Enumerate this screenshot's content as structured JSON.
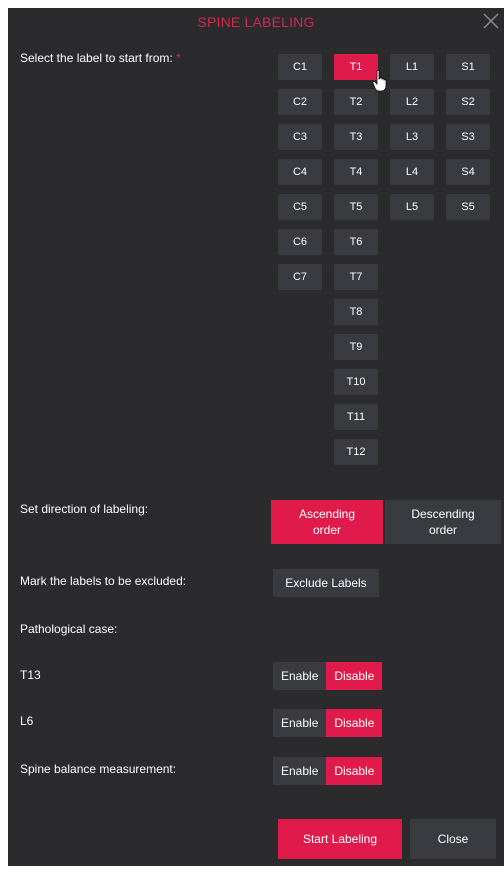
{
  "dialog": {
    "title": "SPINE LABELING",
    "start_prompt": "Select the label to start from:",
    "required_mark": "*",
    "cervical": [
      "C1",
      "C2",
      "C3",
      "C4",
      "C5",
      "C6",
      "C7"
    ],
    "thoracic": [
      "T1",
      "T2",
      "T3",
      "T4",
      "T5",
      "T6",
      "T7",
      "T8",
      "T9",
      "T10",
      "T11",
      "T12"
    ],
    "lumbar": [
      "L1",
      "L2",
      "L3",
      "L4",
      "L5"
    ],
    "sacral": [
      "S1",
      "S2",
      "S3",
      "S4",
      "S5"
    ],
    "selected_label": "T1",
    "direction_label": "Set direction of labeling:",
    "ascending_line1": "Ascending",
    "ascending_line2": "order",
    "descending_line1": "Descending",
    "descending_line2": "order",
    "selected_direction": "ascending",
    "exclude_prompt": "Mark the labels to be excluded:",
    "exclude_button": "Exclude Labels",
    "pathological_label": "Pathological case:",
    "t13_label": "T13",
    "l6_label": "L6",
    "balance_label": "Spine balance measurement:",
    "enable": "Enable",
    "disable": "Disable",
    "t13_state": "Disable",
    "l6_state": "Disable",
    "balance_state": "Disable",
    "start_button": "Start Labeling",
    "close_button": "Close"
  },
  "colors": {
    "accent": "#e01b4b",
    "title": "#d2284d",
    "background": "#2b2b2e",
    "button": "#3a3b40"
  },
  "icons": {
    "close": "close-icon",
    "cursor": "hand-pointer-icon"
  }
}
